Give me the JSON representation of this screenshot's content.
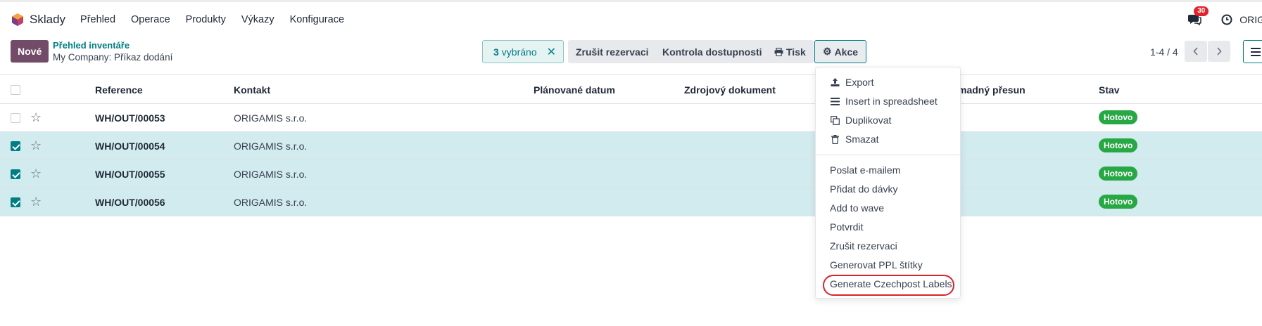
{
  "app": {
    "name": "Sklady",
    "menu": [
      "Přehled",
      "Operace",
      "Produkty",
      "Výkazy",
      "Konfigurace"
    ]
  },
  "systray": {
    "messages_count": "30",
    "company": "ORIG"
  },
  "control_panel": {
    "new_button": "Nové",
    "breadcrumb_parent": "Přehled inventáře",
    "breadcrumb_current": "My Company: Příkaz dodání",
    "selection": {
      "count": "3",
      "label": "vybráno"
    },
    "buttons": {
      "cancel_reservation": "Zrušit rezervaci",
      "check_availability": "Kontrola dostupnosti",
      "print": "Tisk",
      "actions": "Akce"
    },
    "pager": "1-4 / 4"
  },
  "table": {
    "columns": [
      "Reference",
      "Kontakt",
      "Plánované datum",
      "Zdrojový dokument",
      "madný přesun",
      "Stav"
    ],
    "rows": [
      {
        "reference": "WH/OUT/00053",
        "contact": "ORIGAMIS s.r.o.",
        "status": "Hotovo",
        "selected": false
      },
      {
        "reference": "WH/OUT/00054",
        "contact": "ORIGAMIS s.r.o.",
        "status": "Hotovo",
        "selected": true
      },
      {
        "reference": "WH/OUT/00055",
        "contact": "ORIGAMIS s.r.o.",
        "status": "Hotovo",
        "selected": true
      },
      {
        "reference": "WH/OUT/00056",
        "contact": "ORIGAMIS s.r.o.",
        "status": "Hotovo",
        "selected": true
      }
    ]
  },
  "actions_menu": {
    "group1": [
      {
        "label": "Export",
        "icon": "upload-icon"
      },
      {
        "label": "Insert in spreadsheet",
        "icon": "list-icon"
      },
      {
        "label": "Duplikovat",
        "icon": "copy-icon"
      },
      {
        "label": "Smazat",
        "icon": "trash-icon"
      }
    ],
    "group2": [
      "Poslat e-mailem",
      "Přidat do dávky",
      "Add to wave",
      "Potvrdit",
      "Zrušit rezervaci",
      "Generovat PPL štítky",
      "Generate Czechpost Labels"
    ]
  },
  "colors": {
    "brand": "#714b67",
    "accent": "#017e84",
    "selected_row": "#d2ebee",
    "status_done": "#28a745",
    "highlight": "#d9232a"
  }
}
